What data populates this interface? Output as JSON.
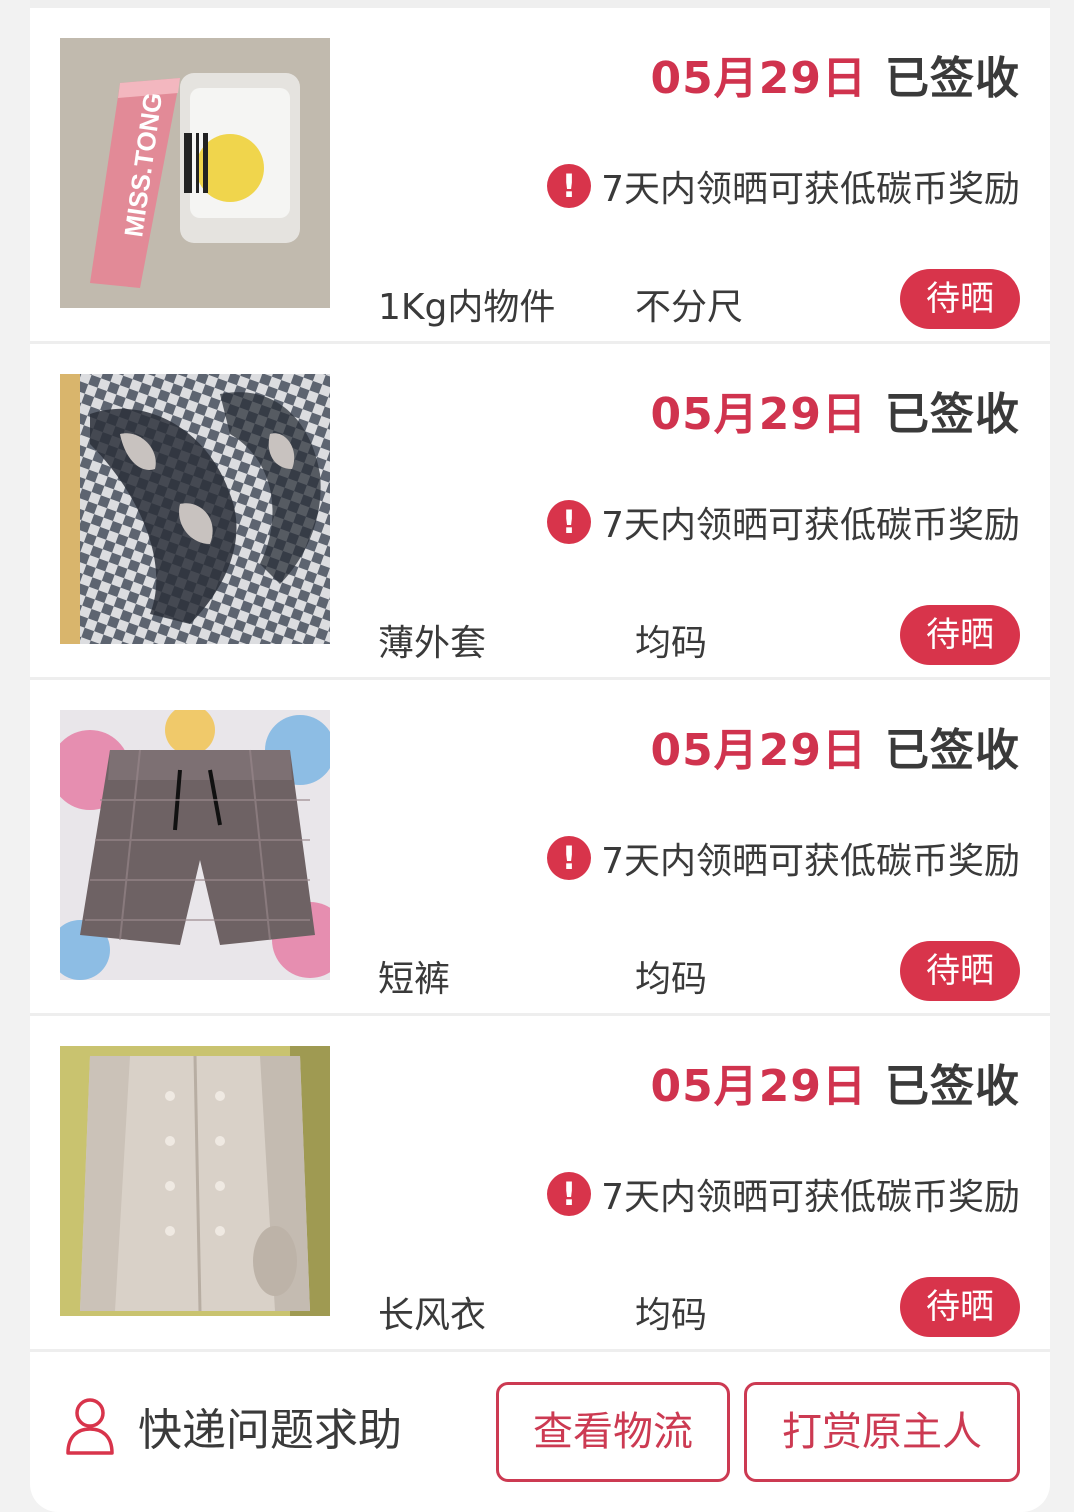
{
  "items": [
    {
      "date": "05月29日",
      "status": "已签收",
      "notice": "7天内领晒可获低碳币奖励",
      "name": "1Kg内物件",
      "size": "不分尺",
      "button": "待晒",
      "thumb_brand_text": "MISS.TONG"
    },
    {
      "date": "05月29日",
      "status": "已签收",
      "notice": "7天内领晒可获低碳币奖励",
      "name": "薄外套",
      "size": "均码",
      "button": "待晒"
    },
    {
      "date": "05月29日",
      "status": "已签收",
      "notice": "7天内领晒可获低碳币奖励",
      "name": "短裤",
      "size": "均码",
      "button": "待晒"
    },
    {
      "date": "05月29日",
      "status": "已签收",
      "notice": "7天内领晒可获低碳币奖励",
      "name": "长风衣",
      "size": "均码",
      "button": "待晒"
    }
  ],
  "notice_icon": "!",
  "footer": {
    "help_label": "快递问题求助",
    "help_icon": "person-outline-icon",
    "logistics_label": "查看物流",
    "reward_label": "打赏原主人"
  },
  "colors": {
    "accent": "#d8344b",
    "text": "#3a3a3a",
    "background": "#f2f2f2"
  }
}
